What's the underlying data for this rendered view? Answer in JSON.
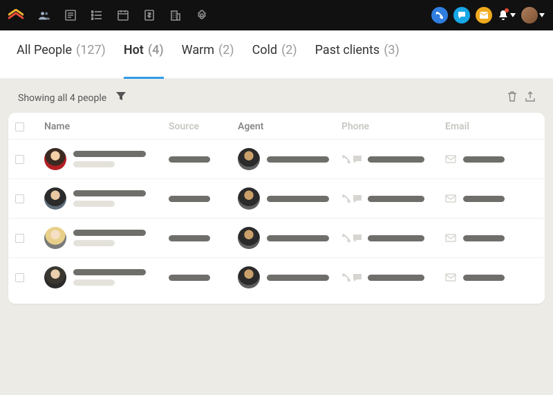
{
  "colors": {
    "tab_underline": "#2f9ae6",
    "call_btn": "#2f7ee0",
    "chat_btn": "#17a7e7",
    "mail_btn": "#f0aa1f",
    "bg": "#ecebe6"
  },
  "nav_icons": [
    "people-icon",
    "note-icon",
    "list-icon",
    "calendar-icon",
    "money-icon",
    "building-icon",
    "settings-icon"
  ],
  "action_circles": [
    "call-icon",
    "chat-icon",
    "mail-icon"
  ],
  "tabs": [
    {
      "label": "All People",
      "count": "(127)",
      "active": false
    },
    {
      "label": "Hot",
      "count": "(4)",
      "active": true
    },
    {
      "label": "Warm",
      "count": "(2)",
      "active": false
    },
    {
      "label": "Cold",
      "count": "(2)",
      "active": false
    },
    {
      "label": "Past clients",
      "count": "(3)",
      "active": false
    }
  ],
  "toolbar": {
    "showing_text": "Showing all 4 people"
  },
  "columns": {
    "name": "Name",
    "source": "Source",
    "agent": "Agent",
    "phone": "Phone",
    "email": "Email"
  },
  "row_count": 4
}
